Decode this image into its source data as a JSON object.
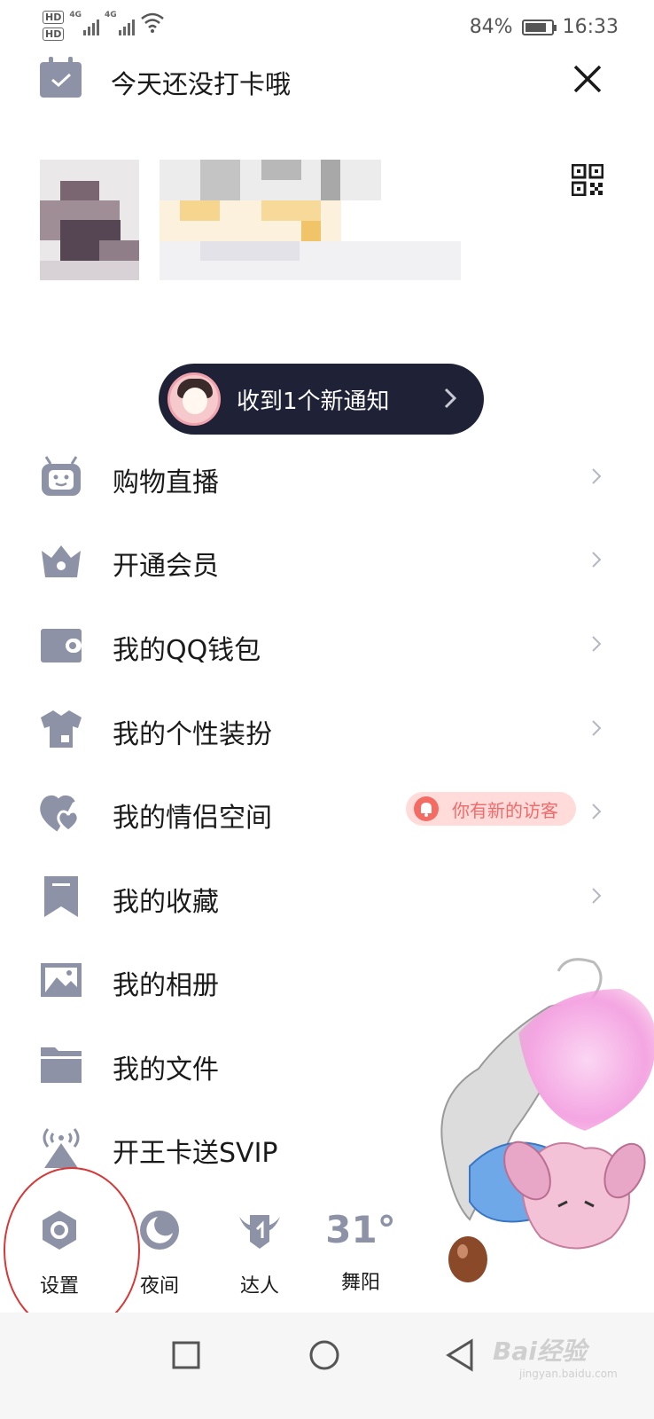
{
  "status_bar": {
    "hd1": "HD",
    "hd2": "HD",
    "net1": "4G",
    "net2": "4G",
    "battery": "84%",
    "battery_level": 0.84,
    "time": "16:33"
  },
  "checkin": {
    "text": "今天还没打卡哦"
  },
  "notification": {
    "text": "收到1个新通知"
  },
  "menu": {
    "items": [
      {
        "label": "购物直播",
        "icon": "tv-robot-icon"
      },
      {
        "label": "开通会员",
        "icon": "crown-icon"
      },
      {
        "label": "我的QQ钱包",
        "icon": "wallet-icon"
      },
      {
        "label": "我的个性装扮",
        "icon": "shirt-icon"
      },
      {
        "label": "我的情侣空间",
        "icon": "hearts-icon",
        "badge": "你有新的访客"
      },
      {
        "label": "我的收藏",
        "icon": "bookmark-icon"
      },
      {
        "label": "我的相册",
        "icon": "image-icon"
      },
      {
        "label": "我的文件",
        "icon": "folder-icon"
      },
      {
        "label": "开王卡送SVIP",
        "icon": "broadcast-icon"
      }
    ]
  },
  "bottom_bar": {
    "settings": "设置",
    "night": "夜间",
    "expert": "达人",
    "temperature": "31°",
    "city": "舞阳"
  },
  "watermark": {
    "brand": "Bai经验",
    "sub": "jingyan.baidu.com"
  },
  "colors": {
    "icon_gray": "#8d92a7",
    "pill_bg": "#1f2137",
    "badge_bg": "#ffdbd9",
    "badge_text": "#f16b6b",
    "annotation_red": "#d63838"
  }
}
